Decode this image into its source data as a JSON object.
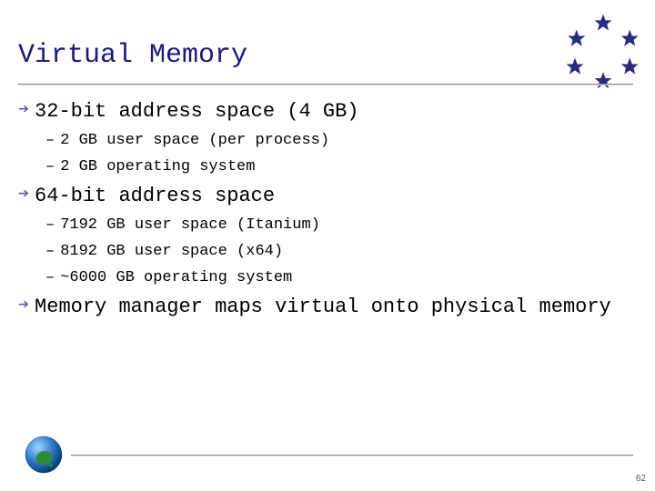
{
  "title": "Virtual Memory",
  "bullets": {
    "b1": {
      "text": "32-bit address space (4 GB)",
      "sub": [
        "2 GB user space (per process)",
        "2 GB operating system"
      ]
    },
    "b2": {
      "text": "64-bit address space",
      "sub": [
        "7192 GB user space (Itanium)",
        "8192 GB user space (x64)",
        "~6000 GB operating system"
      ]
    },
    "b3": {
      "text": "Memory manager maps virtual onto physical memory",
      "sub": []
    }
  },
  "page_number": "62",
  "colors": {
    "title": "#1a1a7a",
    "bullet_arrow": "#5a5ab0",
    "star_fill": "#2a2a80"
  },
  "icons": {
    "top_right": "star-ring-logo",
    "bottom_left": "globe-australia-icon"
  }
}
